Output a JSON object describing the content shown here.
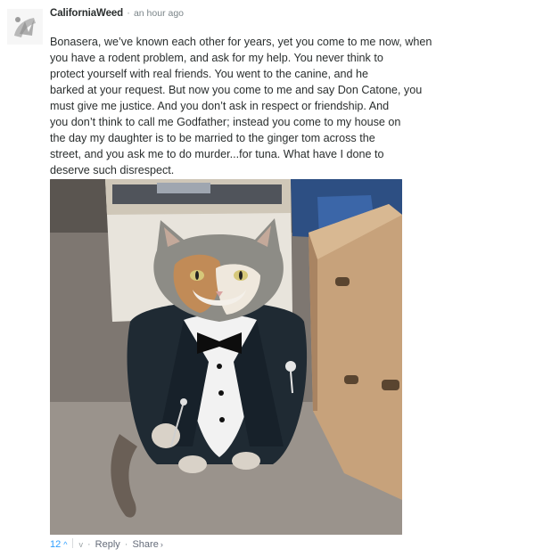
{
  "comment": {
    "author": "CaliforniaWeed",
    "separator": "·",
    "timestamp": "an hour ago",
    "body": "Bonasera, we’ve known each other for years, yet you come to me now, when\nyou have a rodent problem, and ask for my help. You never think to\nprotect yourself with real friends. You went to the canine, and he\nbarked at your request. But now you come to me and say Don Catone, you\nmust give me justice. And you don’t ask in respect or friendship. And\nyou don’t think to call me Godfather; instead you come to my house on\nthe day my daughter is to be married to the ginger tom across the\nstreet, and you ask me to do murder...for tuna. What have I done to\ndeserve such disrespect.",
    "image_alt": "cat wearing a tuxedo standing in front of cardboard boxes"
  },
  "footer": {
    "vote_count": "12",
    "up_glyph": "^",
    "down_glyph": "v",
    "dot": "·",
    "reply_label": "Reply",
    "share_label": "Share",
    "share_chevron": "›"
  },
  "colors": {
    "accent": "#2e9fff",
    "text": "#2a2e2e",
    "muted": "#656c7a"
  }
}
